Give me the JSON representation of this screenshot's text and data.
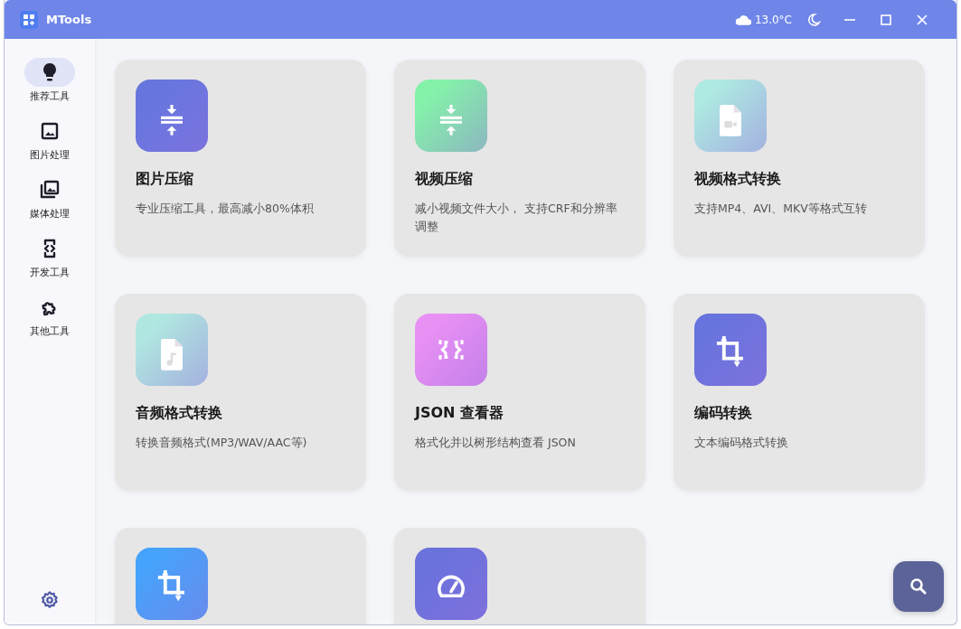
{
  "window": {
    "title": "MTools",
    "weather": "13.0°C"
  },
  "sidebar": {
    "items": [
      {
        "label": "推荐工具",
        "kind": "bulb",
        "selected": true
      },
      {
        "label": "图片处理",
        "kind": "image",
        "selected": false
      },
      {
        "label": "媒体处理",
        "kind": "gallery",
        "selected": false
      },
      {
        "label": "开发工具",
        "kind": "code",
        "selected": false
      },
      {
        "label": "其他工具",
        "kind": "puzzle",
        "selected": false
      }
    ]
  },
  "tools": [
    {
      "title": "图片压缩",
      "description": "专业压缩工具，最高减小80%体积",
      "kind": "compress",
      "color": "#6676df"
    },
    {
      "title": "视频压缩",
      "description": "减小视频文件大小， 支持CRF和分辨率调整",
      "kind": "compress",
      "color": "#84f3a9"
    },
    {
      "title": "视频格式转换",
      "description": "支持MP4、AVI、MKV等格式互转",
      "kind": "video-file",
      "color": "#aee9e2"
    },
    {
      "title": "音频格式转换",
      "description": "转换音频格式(MP3/WAV/AAC等)",
      "kind": "audio-file",
      "color": "#b0e8e1"
    },
    {
      "title": "JSON 查看器",
      "description": "格式化并以树形结构查看 JSON",
      "kind": "json",
      "color": "#e990f4"
    },
    {
      "title": "编码转换",
      "description": "文本编码格式转换",
      "kind": "crop",
      "color": "#6874dd"
    },
    {
      "kind": "crop",
      "color": "#45a3fb"
    },
    {
      "kind": "gauge",
      "color": "#6a72dc"
    }
  ]
}
